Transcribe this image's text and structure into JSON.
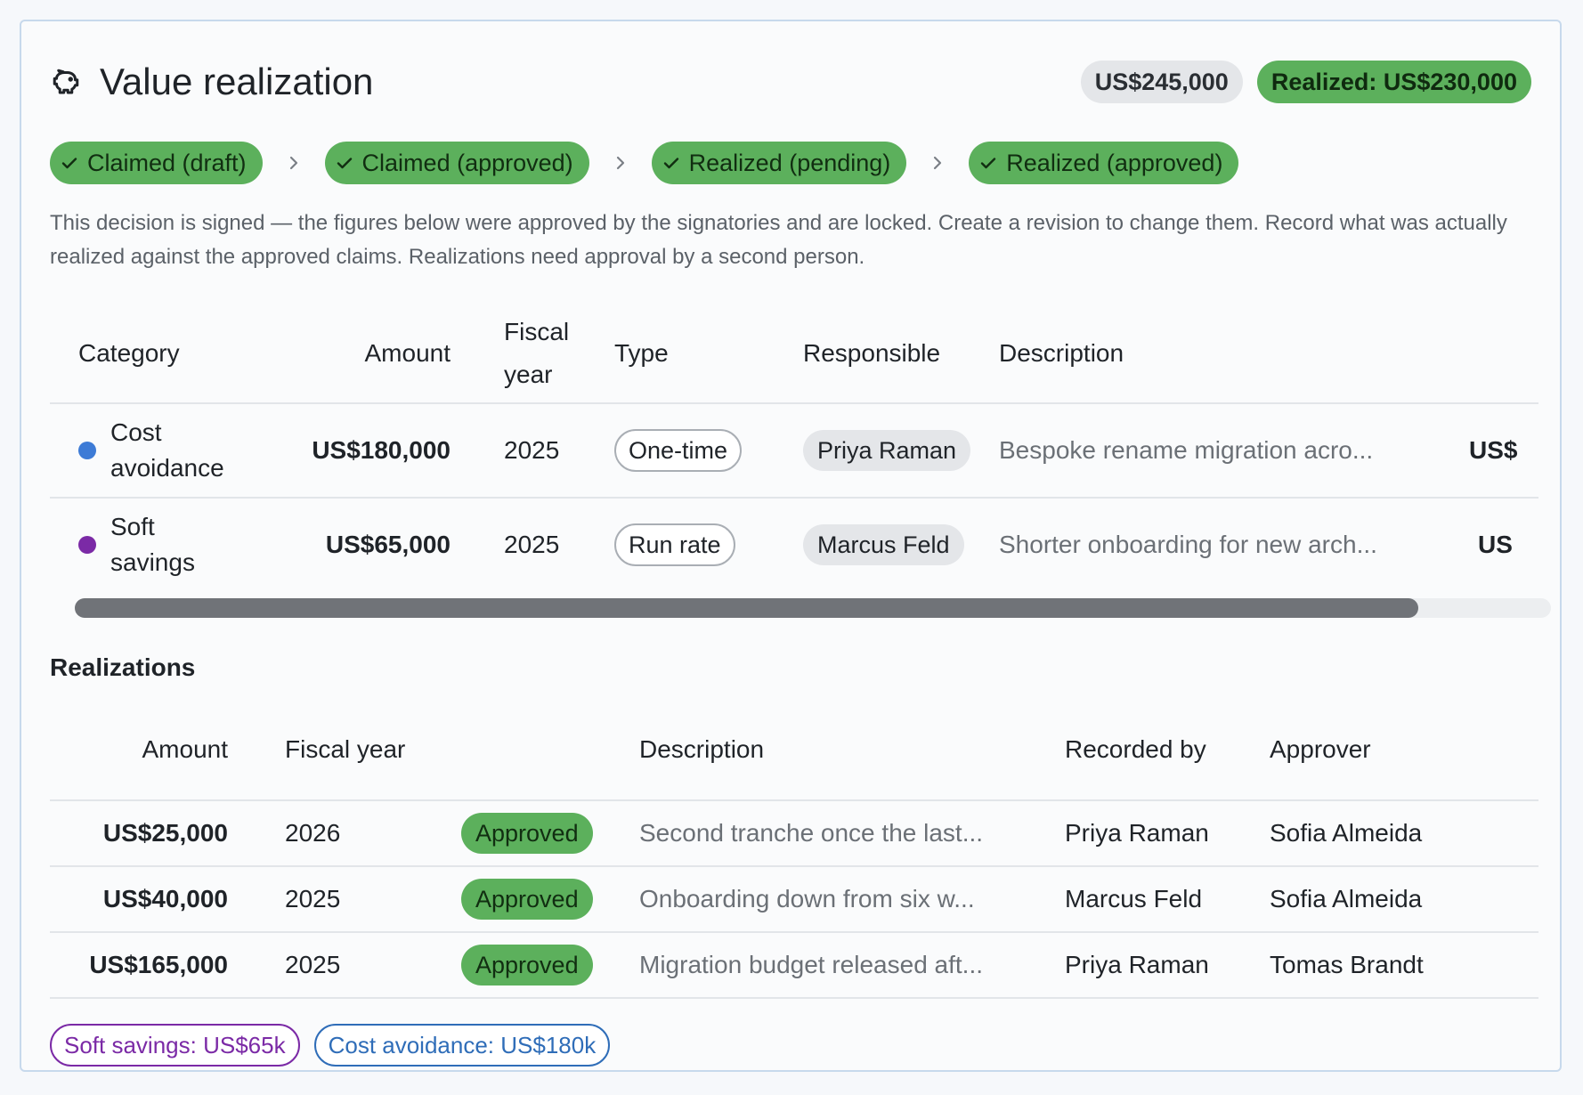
{
  "header": {
    "title": "Value realization",
    "icon": "piggy-bank-icon",
    "total_label": "US$245,000",
    "realized_label": "Realized: US$230,000"
  },
  "stages": [
    {
      "label": "Claimed (draft)",
      "done": true
    },
    {
      "label": "Claimed (approved)",
      "done": true
    },
    {
      "label": "Realized (pending)",
      "done": true
    },
    {
      "label": "Realized (approved)",
      "done": true
    }
  ],
  "note": "This decision is signed — the figures below were approved by the signatories and are locked. Create a revision to change them. Record what was actually realized against the approved claims. Realizations need approval by a second person.",
  "claims": {
    "columns": {
      "category": "Category",
      "amount": "Amount",
      "fiscal_year": "Fiscal year",
      "type": "Type",
      "responsible": "Responsible",
      "description": "Description"
    },
    "rows": [
      {
        "category": "Cost avoidance",
        "category_color": "#3d7bd6",
        "amount": "US$180,000",
        "fiscal_year": "2025",
        "type": "One-time",
        "responsible": "Priya Raman",
        "description": "Bespoke rename migration acro...",
        "overflow": "US$"
      },
      {
        "category": "Soft savings",
        "category_color": "#7b2aa6",
        "amount": "US$65,000",
        "fiscal_year": "2025",
        "type": "Run rate",
        "responsible": "Marcus Feld",
        "description": "Shorter onboarding for new arch...",
        "overflow": "US"
      }
    ],
    "scroll_fraction": 0.91
  },
  "realizations": {
    "title": "Realizations",
    "columns": {
      "amount": "Amount",
      "fiscal_year": "Fiscal year",
      "status": "",
      "description": "Description",
      "recorded_by": "Recorded by",
      "approver": "Approver"
    },
    "rows": [
      {
        "amount": "US$25,000",
        "fiscal_year": "2026",
        "status": "Approved",
        "description": "Second tranche once the last...",
        "recorded_by": "Priya Raman",
        "approver": "Sofia Almeida"
      },
      {
        "amount": "US$40,000",
        "fiscal_year": "2025",
        "status": "Approved",
        "description": "Onboarding down from six w...",
        "recorded_by": "Marcus Feld",
        "approver": "Sofia Almeida"
      },
      {
        "amount": "US$165,000",
        "fiscal_year": "2025",
        "status": "Approved",
        "description": "Migration budget released aft...",
        "recorded_by": "Priya Raman",
        "approver": "Tomas Brandt"
      }
    ]
  },
  "legend": [
    {
      "label": "Soft savings: US$65k",
      "color": "#7b2aa6"
    },
    {
      "label": "Cost avoidance: US$180k",
      "color": "#2f6db8"
    }
  ],
  "colors": {
    "accent_green": "#5cb05c",
    "border": "#c7d9ec"
  }
}
